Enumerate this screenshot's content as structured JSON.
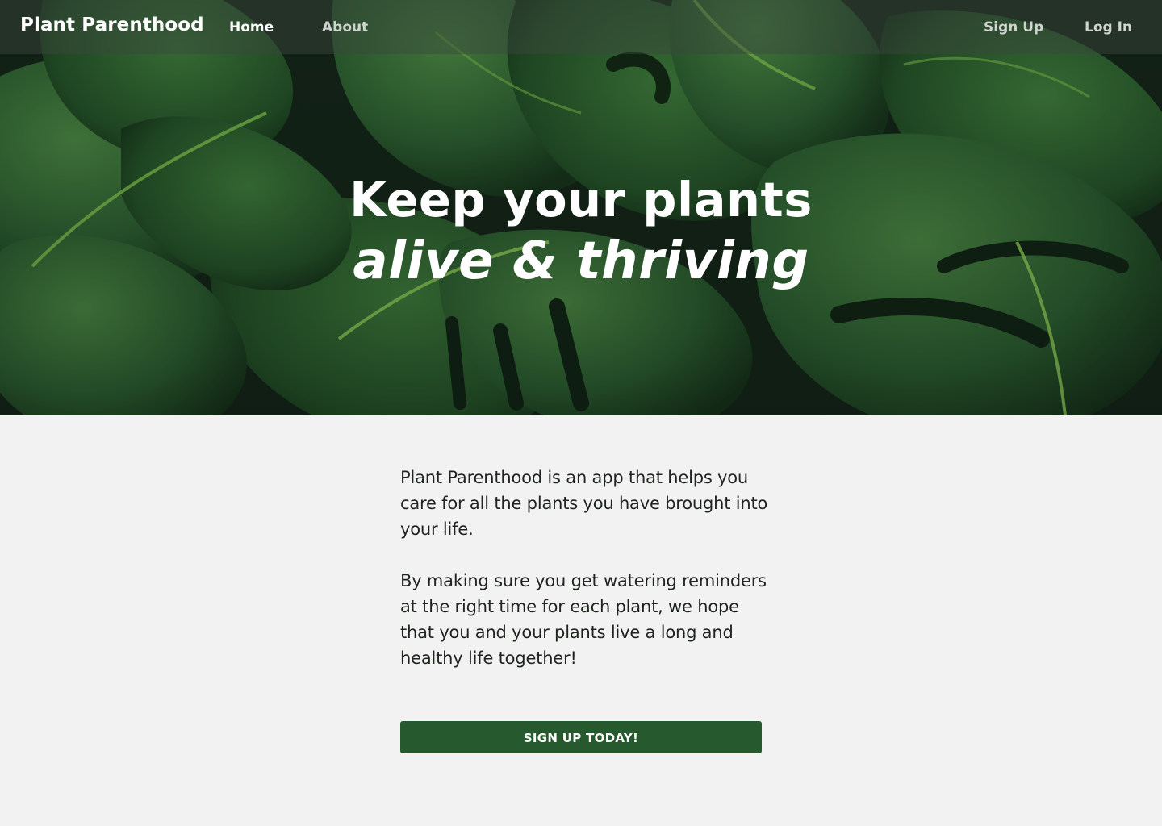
{
  "nav": {
    "brand": "Plant Parenthood",
    "links": [
      {
        "label": "Home",
        "active": true
      },
      {
        "label": "About",
        "active": false
      }
    ],
    "auth": {
      "signup_label": "Sign Up",
      "login_label": "Log In"
    }
  },
  "hero": {
    "headline_line1": "Keep your plants",
    "headline_line2": "alive & thriving",
    "background_colors": {
      "dark": "#1d3a22",
      "leaf": "#2f6b35",
      "highlight": "#5ea544"
    }
  },
  "about": {
    "paragraph1": "Plant Parenthood is an app that helps you care for all the plants you have brought into your life.",
    "paragraph2": "By making sure you get watering reminders at the right time for each plant, we hope that you and your plants live a long and healthy life together!"
  },
  "cta": {
    "label": "SIGN UP TODAY!",
    "color": "#265a2e"
  },
  "theme": {
    "page_background": "#f1f2f1",
    "text_color": "#1f241f"
  }
}
